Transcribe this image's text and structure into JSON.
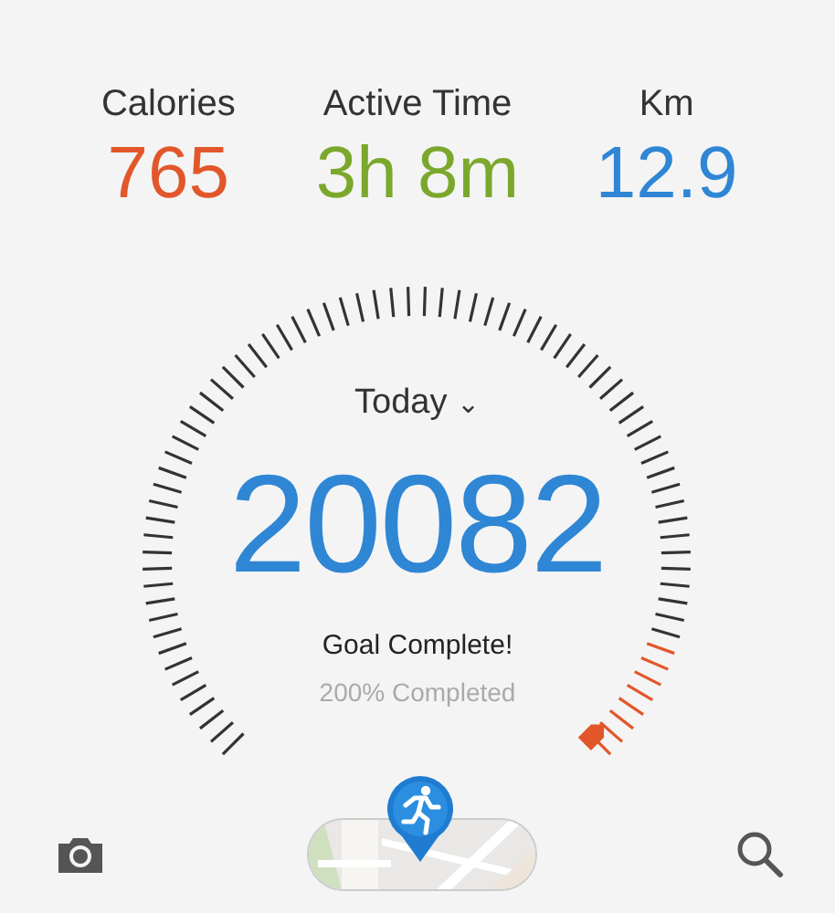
{
  "stats": [
    {
      "label": "Calories",
      "value": "765",
      "color": "#e2572a"
    },
    {
      "label": "Active Time",
      "value": "3h 8m",
      "color": "#7ba82c"
    },
    {
      "label": "Km",
      "value": "12.9",
      "color": "#2f86d4"
    }
  ],
  "gauge": {
    "period": "Today",
    "caret": "⌄",
    "steps": "20082",
    "status": "Goal Complete!",
    "progress": "200% Completed"
  }
}
